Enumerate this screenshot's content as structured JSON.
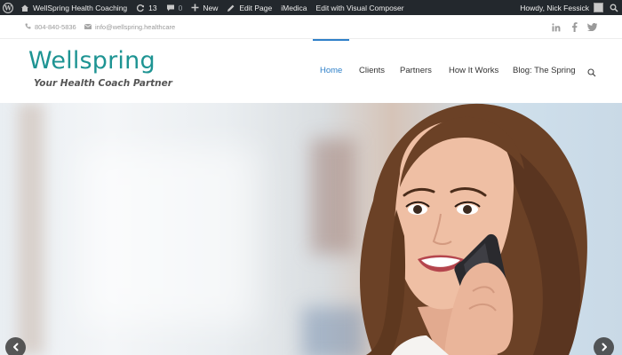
{
  "admin_bar": {
    "site_name": "WellSpring Health Coaching",
    "updates_count": "13",
    "comments_count": "0",
    "new_label": "New",
    "edit_page_label": "Edit Page",
    "imedica_label": "iMedica",
    "visual_composer_label": "Edit with Visual Composer",
    "howdy_text": "Howdy, Nick Fessick"
  },
  "topbar": {
    "phone": "804-840-5836",
    "email": "info@wellspring.healthcare",
    "social_icons": [
      "linkedin-icon",
      "facebook-icon",
      "twitter-icon"
    ]
  },
  "logo": {
    "word": "Wellspring",
    "tagline": "Your Health Coach Partner"
  },
  "nav": {
    "items": [
      {
        "label": "Home",
        "active": true
      },
      {
        "label": "Clients",
        "active": false
      },
      {
        "label": "Partners",
        "active": false
      },
      {
        "label": "How It Works",
        "active": false
      },
      {
        "label": "Blog: The Spring",
        "active": false
      }
    ]
  },
  "hero": {
    "image_description": "smiling woman talking on mobile phone",
    "prev_icon": "chevron-left-icon",
    "next_icon": "chevron-right-icon"
  },
  "colors": {
    "admin_bar_bg": "#23282d",
    "brand_teal": "#1e9493",
    "nav_active": "#2f80c9"
  }
}
